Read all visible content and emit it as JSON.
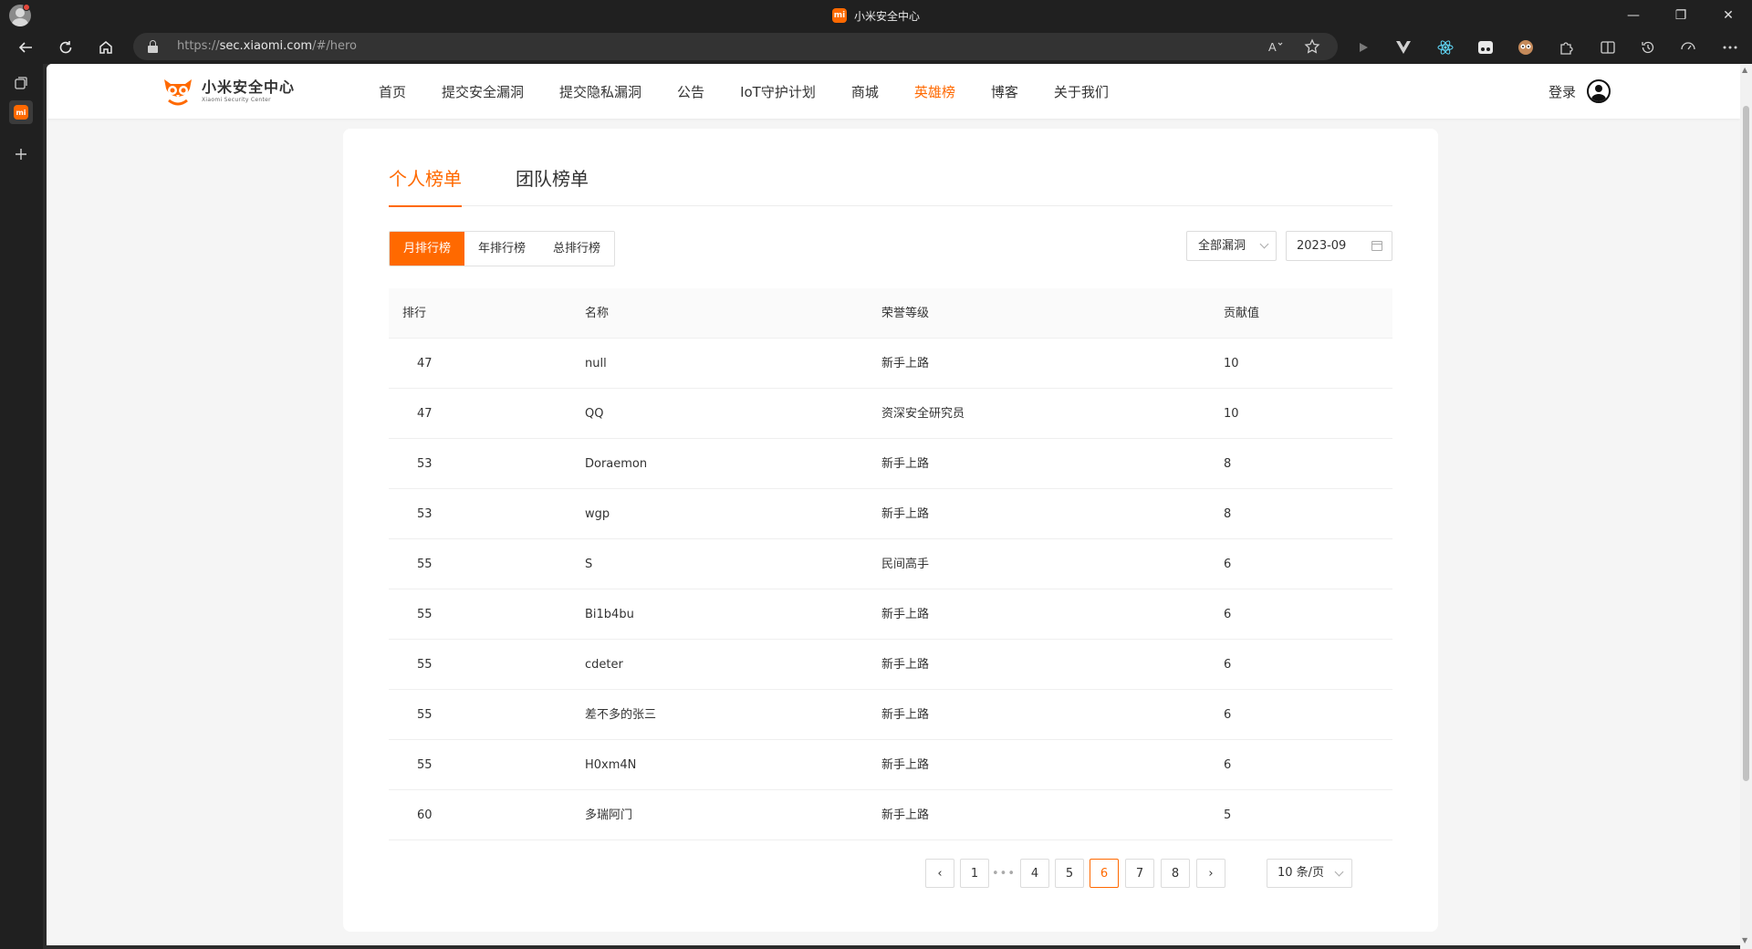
{
  "window": {
    "title": "小米安全中心",
    "tab_icon_text": "mi",
    "controls": {
      "minimize": "—",
      "restore": "❐",
      "close": "✕"
    }
  },
  "addressbar": {
    "url_scheme": "https://",
    "url_host": "sec.xiaomi.com",
    "url_path": "/#/hero"
  },
  "site": {
    "logo_cn": "小米安全中心",
    "logo_en": "Xiaomi Security Center",
    "nav": [
      {
        "label": "首页"
      },
      {
        "label": "提交安全漏洞"
      },
      {
        "label": "提交隐私漏洞"
      },
      {
        "label": "公告"
      },
      {
        "label": "IoT守护计划"
      },
      {
        "label": "商城"
      },
      {
        "label": "英雄榜",
        "active": true
      },
      {
        "label": "博客"
      },
      {
        "label": "关于我们"
      }
    ],
    "login_label": "登录",
    "accent_color": "#ff6900"
  },
  "board": {
    "tabs": [
      {
        "label": "个人榜单",
        "active": true
      },
      {
        "label": "团队榜单"
      }
    ],
    "period_tabs": [
      {
        "label": "月排行榜",
        "active": true
      },
      {
        "label": "年排行榜"
      },
      {
        "label": "总排行榜"
      }
    ],
    "vuln_filter": "全部漏洞",
    "month": "2023-09",
    "columns": {
      "rank": "排行",
      "name": "名称",
      "level": "荣誉等级",
      "score": "贡献值"
    },
    "rows": [
      {
        "rank": "47",
        "name": "null",
        "level": "新手上路",
        "score": "10"
      },
      {
        "rank": "47",
        "name": "QQ",
        "level": "资深安全研究员",
        "score": "10"
      },
      {
        "rank": "53",
        "name": "Doraemon",
        "level": "新手上路",
        "score": "8"
      },
      {
        "rank": "53",
        "name": "wgp",
        "level": "新手上路",
        "score": "8"
      },
      {
        "rank": "55",
        "name": "S",
        "level": "民间高手",
        "score": "6"
      },
      {
        "rank": "55",
        "name": "Bi1b4bu",
        "level": "新手上路",
        "score": "6"
      },
      {
        "rank": "55",
        "name": "cdeter",
        "level": "新手上路",
        "score": "6"
      },
      {
        "rank": "55",
        "name": "差不多的张三",
        "level": "新手上路",
        "score": "6"
      },
      {
        "rank": "55",
        "name": "H0xm4N",
        "level": "新手上路",
        "score": "6"
      },
      {
        "rank": "60",
        "name": "多瑞阿门",
        "level": "新手上路",
        "score": "5"
      }
    ],
    "pagination": {
      "prev": "‹",
      "next": "›",
      "ellipsis": "•••",
      "pages": [
        "1",
        "4",
        "5",
        "6",
        "7",
        "8"
      ],
      "current": "6",
      "page_size": "10 条/页"
    }
  }
}
